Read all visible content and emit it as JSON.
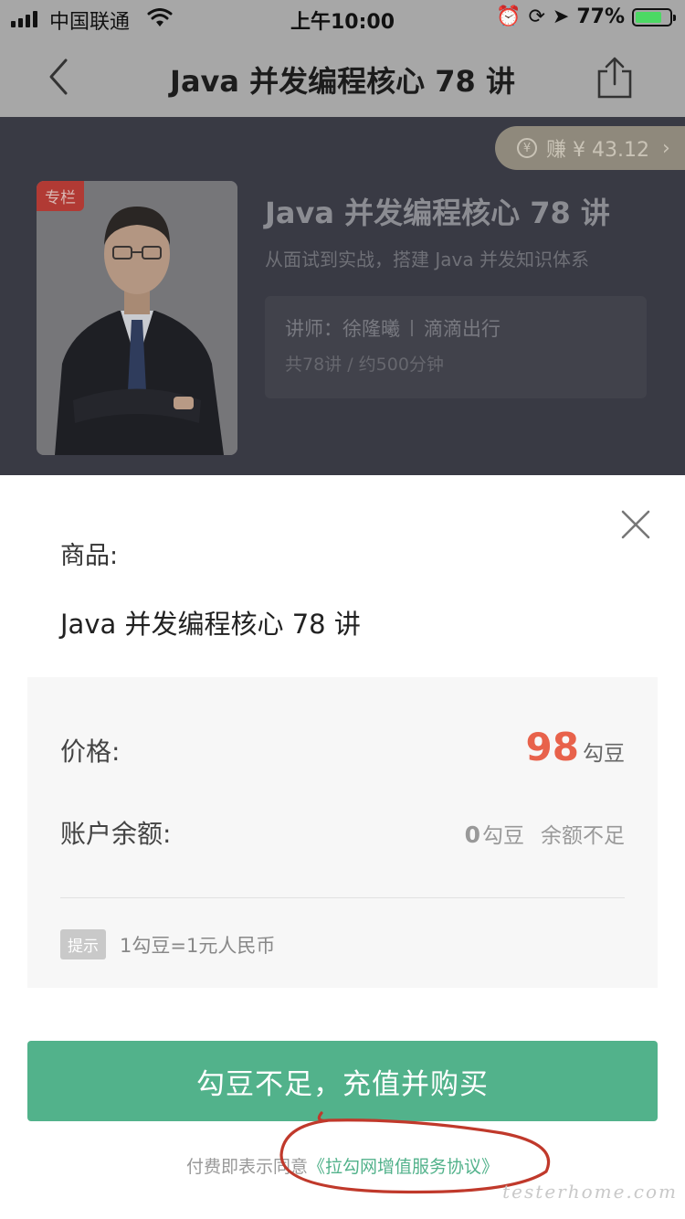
{
  "status_bar": {
    "carrier": "中国联通",
    "time": "上午10:00",
    "battery": "77%",
    "battery_level": 0.77
  },
  "nav": {
    "title": "Java 并发编程核心 78 讲",
    "back_icon": "chevron-left-icon",
    "share_icon": "share-icon"
  },
  "course": {
    "earn": "赚 ¥ 43.12",
    "earn_icon_glyph": "¥",
    "tag": "专栏",
    "title": "Java 并发编程核心 78 讲",
    "subtitle": "从面试到实战，搭建 Java 并发知识体系",
    "teacher_label": "讲师：徐隆曦",
    "teacher_company": "滴滴出行",
    "meta": "共78讲 / 约500分钟"
  },
  "sheet": {
    "product_label": "商品:",
    "product_name": "Java 并发编程核心 78 讲",
    "price_label": "价格:",
    "price_value": "98",
    "price_unit": "勾豆",
    "balance_label": "账户余额:",
    "balance_value": "0",
    "balance_unit": "勾豆",
    "balance_status": "余额不足",
    "hint_badge": "提示",
    "hint_text": "1勾豆=1元人民币",
    "buy_button": "勾豆不足，充值并购买",
    "agreement_prefix": "付费即表示同意",
    "agreement_link": "《拉勾网增值服务协议》"
  },
  "watermark": "testerhome.com",
  "colors": {
    "accent_green": "#52b28b",
    "price_red": "#e8624b",
    "annotation_red": "#c0392b"
  }
}
